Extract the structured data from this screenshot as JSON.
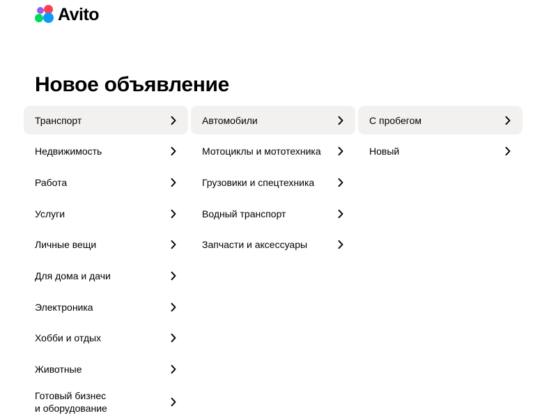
{
  "logo": {
    "text": "Avito"
  },
  "title": "Новое объявление",
  "columns": {
    "level1": [
      {
        "label": "Транспорт",
        "active": true
      },
      {
        "label": "Недвижимость"
      },
      {
        "label": "Работа"
      },
      {
        "label": "Услуги"
      },
      {
        "label": "Личные вещи"
      },
      {
        "label": "Для дома и дачи"
      },
      {
        "label": "Электроника"
      },
      {
        "label": "Хобби и отдых"
      },
      {
        "label": "Животные"
      },
      {
        "label": "Готовый бизнес\nи оборудование"
      }
    ],
    "level2": [
      {
        "label": "Автомобили",
        "active": true
      },
      {
        "label": "Мотоциклы и мототехника"
      },
      {
        "label": "Грузовики и спецтехника"
      },
      {
        "label": "Водный транспорт"
      },
      {
        "label": "Запчасти и аксессуары"
      }
    ],
    "level3": [
      {
        "label": "С пробегом",
        "active": true
      },
      {
        "label": "Новый"
      }
    ]
  },
  "icons": {
    "item_arrow": "chevron-right-icon"
  },
  "colors": {
    "active_bg": "#f2f1f0"
  }
}
